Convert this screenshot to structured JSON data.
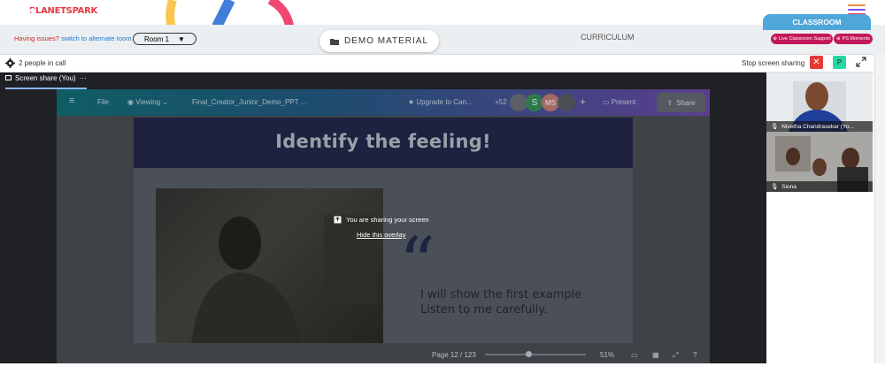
{
  "brand": {
    "logo_text": "PLANETSPARK"
  },
  "header": {
    "issues_text": "Having issues?",
    "issues_link": "switch to alternate room",
    "room_select": "Room 1",
    "demo_material": "DEMO MATERIAL",
    "curriculum": "CURRICULUM",
    "classroom_tab": "CLASSROOM",
    "live_support": "Live Classroom Support",
    "ps_moments": "PS Moments"
  },
  "call_bar": {
    "people": "2 people in call",
    "stop_sharing": "Stop screen sharing",
    "p_badge": "P"
  },
  "share_tab": {
    "label": "Screen share (You)",
    "more": "···"
  },
  "canva": {
    "menu_icon": "≡",
    "file": "File",
    "viewing": "Viewing",
    "doc_name": "Final_Creator_Junior_Demo_PPT ...",
    "upgrade": "Upgrade to Can...",
    "plus_count": "+52",
    "avatar_s": "S",
    "avatar_ms": "MS",
    "present": "Present",
    "share": "Share",
    "page_label": "Page 12 / 123",
    "zoom": "51%"
  },
  "slide": {
    "title": "Identify the feeling!",
    "quote_mark": "“",
    "line1": "I will show the first example",
    "line2": "Listen to me carefully."
  },
  "overlay": {
    "message": "You are sharing your screen",
    "hide": "Hide this overlay"
  },
  "participants": [
    {
      "name": "Nivetha Chandrasekar (Yo..."
    },
    {
      "name": "Siona"
    }
  ],
  "colors": {
    "brand_red": "#e63946",
    "accent_blue": "#4fa6d8",
    "pink": "#c2185b",
    "stop_red": "#e53935",
    "green": "#26d9a4"
  }
}
